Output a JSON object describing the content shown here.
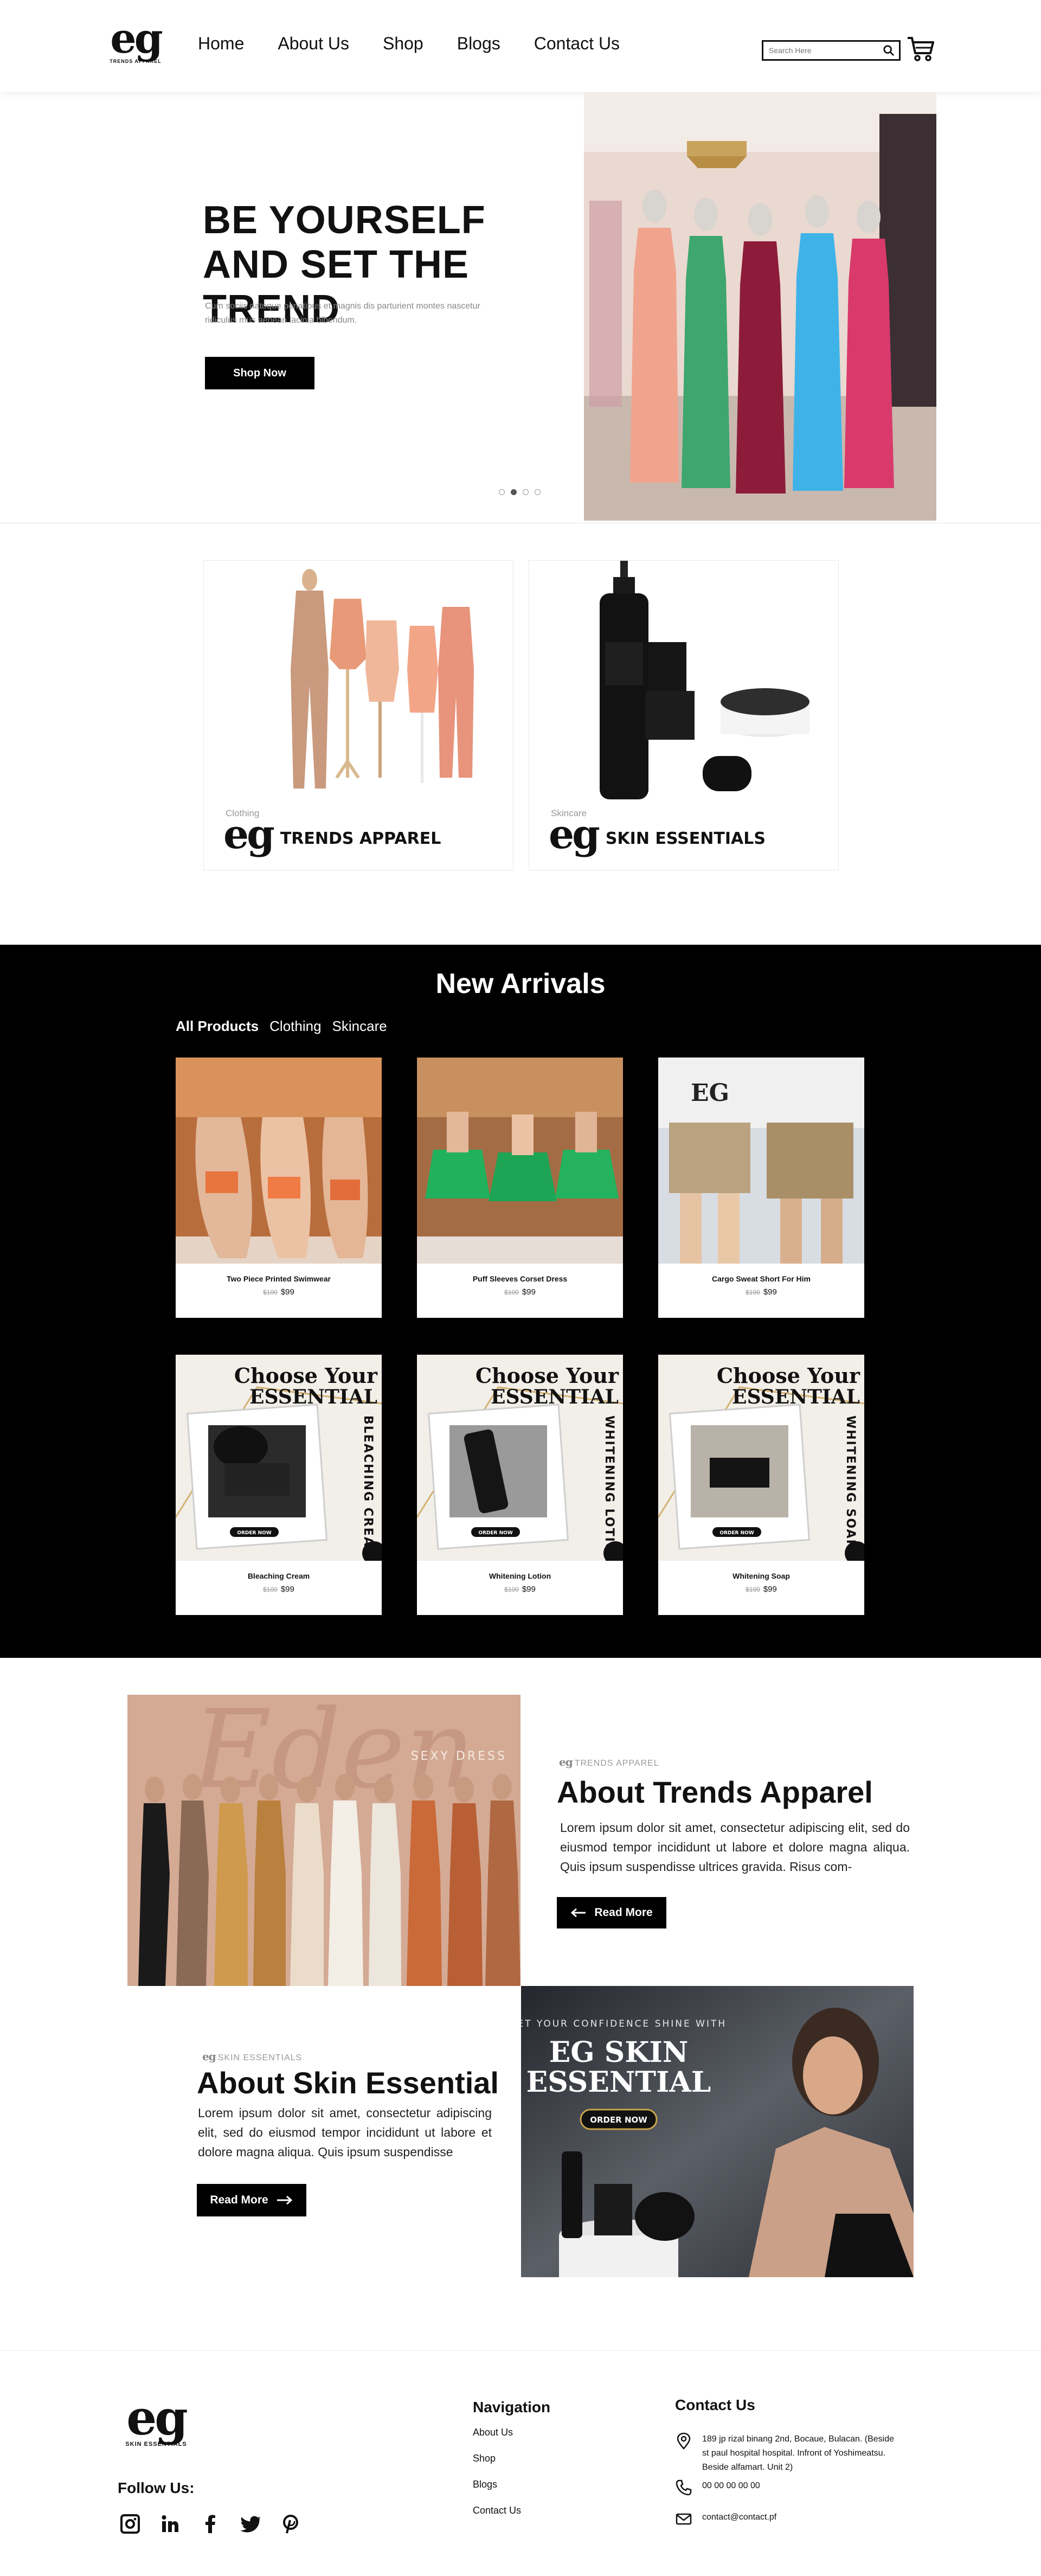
{
  "brand": {
    "logo_mark": "eg",
    "logo_sub": "TRENDS APPAREL",
    "footer_logo_sub": "SKIN ESSENTIALS"
  },
  "nav": {
    "items": [
      "Home",
      "About Us",
      "Shop",
      "Blogs",
      "Contact Us"
    ]
  },
  "search": {
    "placeholder": "Search Here",
    "icon": "search-icon"
  },
  "cart": {
    "icon": "cart-icon"
  },
  "hero": {
    "title": "BE YOURSELF AND SET THE TREND",
    "subtitle": "Cum sociis natoque penatibus et magnis dis parturient montes nascetur ridiculus mus aenean lacinia bibendum.",
    "button": "Shop Now",
    "slides": 4,
    "active_slide": 2
  },
  "categories": [
    {
      "small": "Clothing",
      "mark": "eg",
      "name": "TRENDS APPAREL"
    },
    {
      "small": "Skincare",
      "mark": "eg",
      "name": "SKIN ESSENTIALS"
    }
  ],
  "arrivals": {
    "title": "New Arrivals",
    "filters": [
      "All Products",
      "Clothing",
      "Skincare"
    ],
    "active_filter": "All Products",
    "watermark": "EG TRENDS APPAREL",
    "products": [
      {
        "name": "Two Piece Printed Swimwear",
        "old_price": "$100",
        "price": "$99"
      },
      {
        "name": "Puff Sleeves Corset Dress",
        "old_price": "$100",
        "price": "$99"
      },
      {
        "name": "Cargo Sweat Short For Him",
        "old_price": "$100",
        "price": "$99"
      },
      {
        "name": "Bleaching Cream",
        "old_price": "$100",
        "price": "$99",
        "promo_top": "Choose Your",
        "promo_main": "ESSENTIAL",
        "promo_side": "BLEACHING CREAM",
        "promo_btn": "ORDER NOW"
      },
      {
        "name": "Whitening Lotion",
        "old_price": "$100",
        "price": "$99",
        "promo_top": "Choose Your",
        "promo_main": "ESSENTIAL",
        "promo_side": "WHITENING LOTION",
        "promo_btn": "ORDER NOW"
      },
      {
        "name": "Whitening Soap",
        "old_price": "$100",
        "price": "$99",
        "promo_top": "Choose Your",
        "promo_main": "ESSENTIAL",
        "promo_side": "WHITENING SOAP",
        "promo_btn": "ORDER NOW"
      }
    ]
  },
  "about_trends": {
    "image_tag": "SEXY DRESS",
    "mini_mark": "eg",
    "mini_label": "TRENDS APPAREL",
    "title": "About Trends Apparel",
    "body": "Lorem ipsum dolor sit amet, consectetur adipiscing elit, sed do eiusmod tempor incididunt ut labore et dolore magna aliqua. Quis ipsum suspendisse ultrices gravida. Risus com-",
    "button": "Read More"
  },
  "about_skin": {
    "mini_mark": "eg",
    "mini_label": "SKIN ESSENTIALS",
    "title": "About Skin Essential",
    "body": "Lorem ipsum dolor sit amet, consectetur adipiscing elit, sed do eiusmod tempor incididunt ut labore et dolore magna aliqua. Quis ipsum suspendisse",
    "button": "Read More",
    "banner_small": "LET YOUR CONFIDENCE SHINE WITH",
    "banner_title_1": "EG SKIN",
    "banner_title_2": "ESSENTIAL",
    "banner_btn": "ORDER NOW"
  },
  "footer": {
    "follow": "Follow Us:",
    "socials": [
      "instagram-icon",
      "linkedin-icon",
      "facebook-icon",
      "twitter-icon",
      "pinterest-icon"
    ],
    "nav_title": "Navigation",
    "nav_links": [
      "About Us",
      "Shop",
      "Blogs",
      "Contact Us"
    ],
    "contact_title": "Contact Us",
    "address": "189 jp rizal binang 2nd, Bocaue, Bulacan. (Beside st paul hospital hospital. Infront of Yoshimeatsu. Beside alfamart. Unit 2)",
    "phone": "00 00 00 00 00",
    "email": "contact@contact.pf"
  },
  "colors": {
    "dark": "#000000",
    "accent_gold": "#c9a24a",
    "muted": "#999999"
  }
}
